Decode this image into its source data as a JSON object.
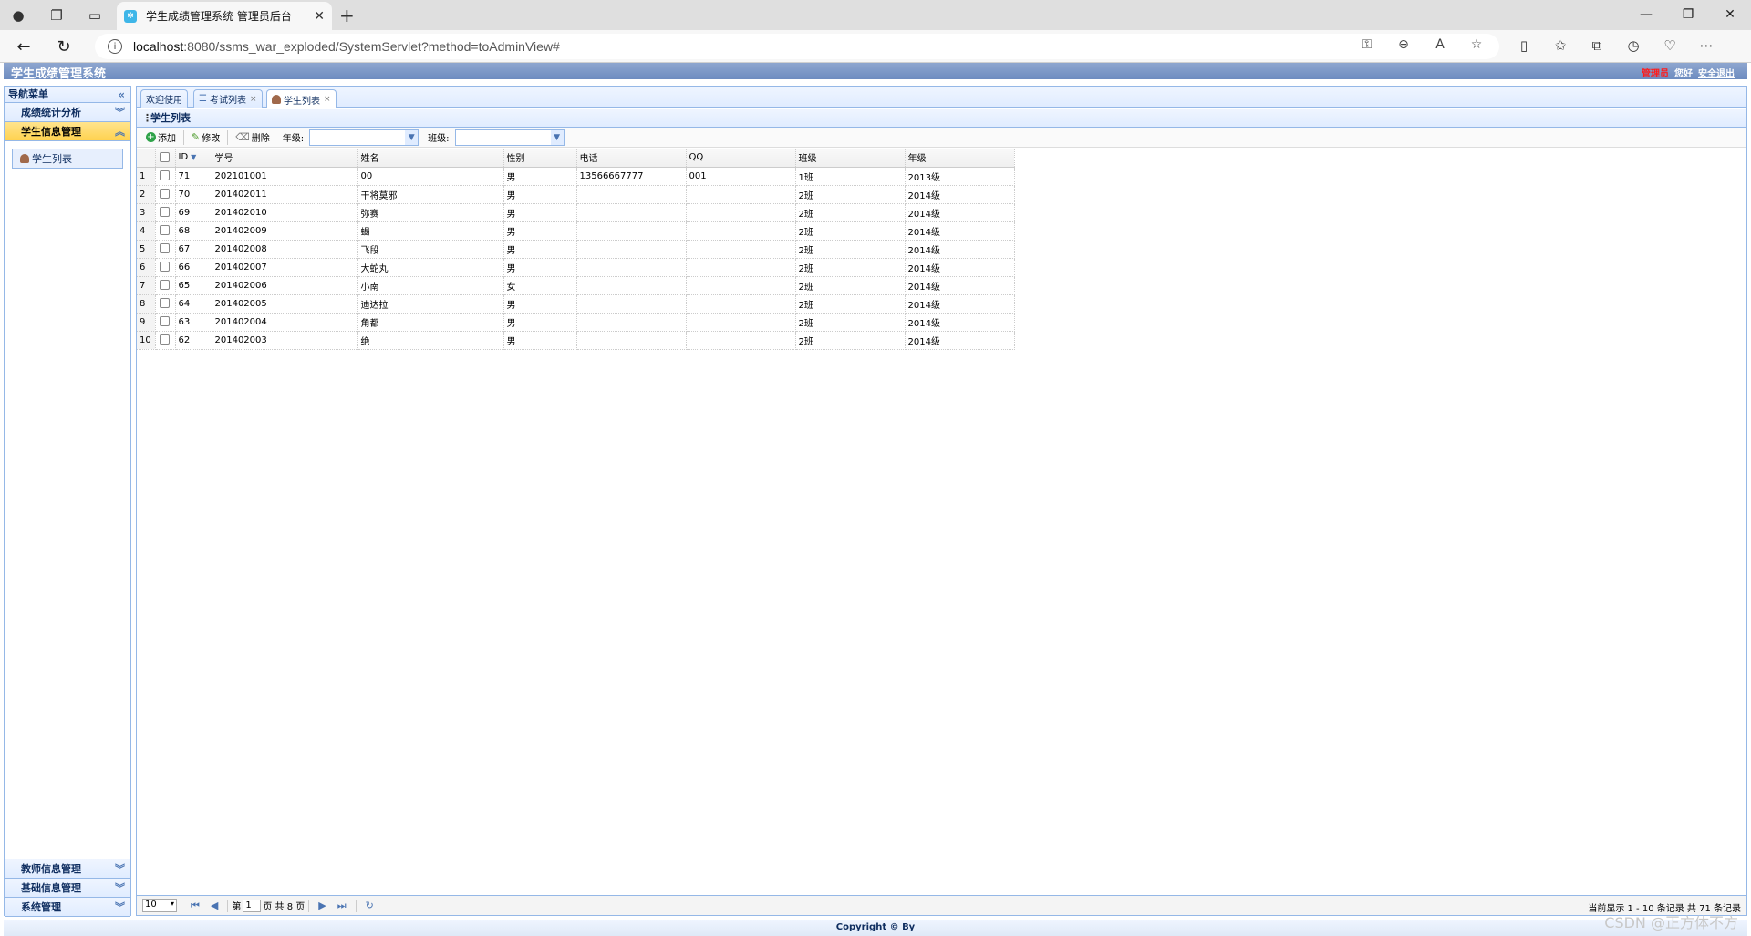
{
  "browser": {
    "tab_title": "学生成绩管理系统 管理员后台",
    "url_host": "localhost",
    "url_path": ":8080/ssms_war_exploded/SystemServlet?method=toAdminView#"
  },
  "header": {
    "title": "学生成绩管理系统",
    "role": "管理员",
    "greeting": "您好",
    "logout": "安全退出"
  },
  "sidebar": {
    "title": "导航菜单",
    "top_sections": [
      {
        "label": "成绩统计分析"
      },
      {
        "label": "学生信息管理"
      }
    ],
    "active_item": "学生列表",
    "bottom_sections": [
      {
        "label": "教师信息管理"
      },
      {
        "label": "基础信息管理"
      },
      {
        "label": "系统管理"
      }
    ]
  },
  "tabs": [
    {
      "label": "欢迎使用"
    },
    {
      "label": "考试列表"
    },
    {
      "label": "学生列表"
    }
  ],
  "panel_title": "学生列表",
  "toolbar": {
    "add": "添加",
    "edit": "修改",
    "delete": "删除",
    "grade_label": "年级:",
    "class_label": "班级:"
  },
  "grid": {
    "columns": [
      "ID",
      "学号",
      "姓名",
      "性别",
      "电话",
      "QQ",
      "班级",
      "年级"
    ],
    "rows": [
      {
        "n": "1",
        "id": "71",
        "sn": "202101001",
        "name": "00",
        "sex": "男",
        "phone": "13566667777",
        "qq": "001",
        "cls": "1班",
        "grade": "2013级"
      },
      {
        "n": "2",
        "id": "70",
        "sn": "201402011",
        "name": "干将莫邪",
        "sex": "男",
        "phone": "",
        "qq": "",
        "cls": "2班",
        "grade": "2014级"
      },
      {
        "n": "3",
        "id": "69",
        "sn": "201402010",
        "name": "弥赛",
        "sex": "男",
        "phone": "",
        "qq": "",
        "cls": "2班",
        "grade": "2014级"
      },
      {
        "n": "4",
        "id": "68",
        "sn": "201402009",
        "name": "蝎",
        "sex": "男",
        "phone": "",
        "qq": "",
        "cls": "2班",
        "grade": "2014级"
      },
      {
        "n": "5",
        "id": "67",
        "sn": "201402008",
        "name": "飞段",
        "sex": "男",
        "phone": "",
        "qq": "",
        "cls": "2班",
        "grade": "2014级"
      },
      {
        "n": "6",
        "id": "66",
        "sn": "201402007",
        "name": "大蛇丸",
        "sex": "男",
        "phone": "",
        "qq": "",
        "cls": "2班",
        "grade": "2014级"
      },
      {
        "n": "7",
        "id": "65",
        "sn": "201402006",
        "name": "小南",
        "sex": "女",
        "phone": "",
        "qq": "",
        "cls": "2班",
        "grade": "2014级"
      },
      {
        "n": "8",
        "id": "64",
        "sn": "201402005",
        "name": "迪达拉",
        "sex": "男",
        "phone": "",
        "qq": "",
        "cls": "2班",
        "grade": "2014级"
      },
      {
        "n": "9",
        "id": "63",
        "sn": "201402004",
        "name": "角都",
        "sex": "男",
        "phone": "",
        "qq": "",
        "cls": "2班",
        "grade": "2014级"
      },
      {
        "n": "10",
        "id": "62",
        "sn": "201402003",
        "name": "绝",
        "sex": "男",
        "phone": "",
        "qq": "",
        "cls": "2班",
        "grade": "2014级"
      }
    ]
  },
  "pager": {
    "page_size": "10",
    "page_prefix": "第",
    "page_value": "1",
    "page_suffix": "页 共 8 页",
    "info": "当前显示 1 - 10 条记录 共 71 条记录"
  },
  "footer": "Copyright © By",
  "watermark": "CSDN @正方体不方",
  "colors": {
    "accent": "#95b8e7",
    "header": "#6d8cc0",
    "active_menu": "#ffd24f",
    "role": "#ff1a1a"
  }
}
